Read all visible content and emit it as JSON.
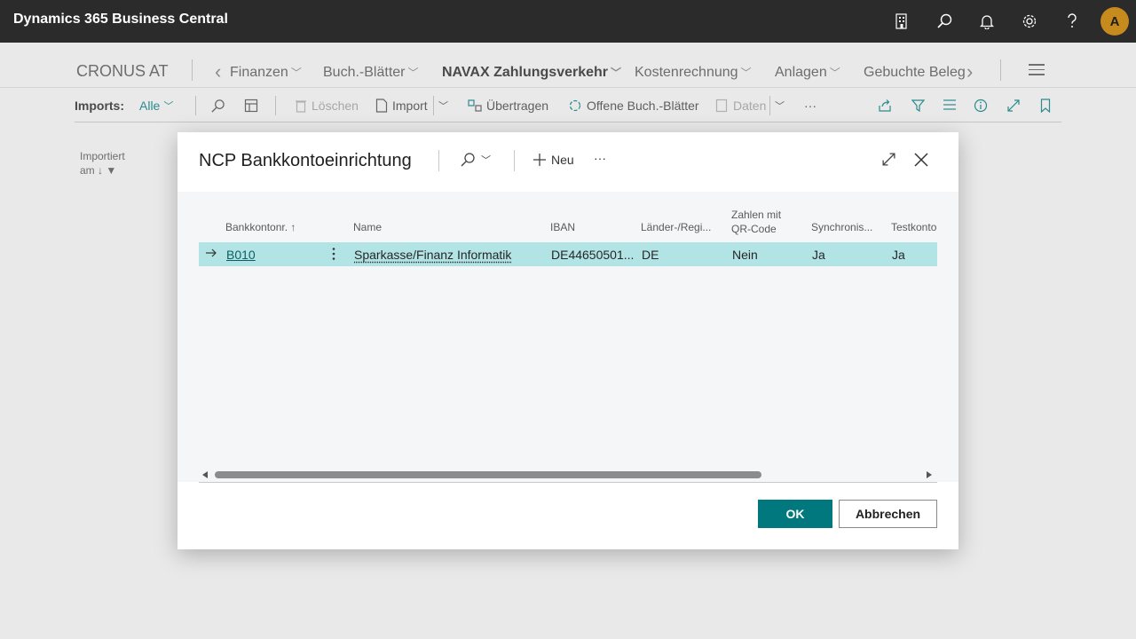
{
  "app": {
    "title": "Dynamics 365 Business Central",
    "avatar_initial": "A"
  },
  "appbar_icons": [
    "company-icon",
    "search-icon",
    "bell-icon",
    "gear-icon",
    "help-icon"
  ],
  "page": {
    "company": "CRONUS AT",
    "nav": [
      {
        "label": "Finanzen"
      },
      {
        "label": "Buch.-Blätter"
      },
      {
        "label": "NAVAX Zahlungsverkehr"
      },
      {
        "label": "Kostenrechnung"
      },
      {
        "label": "Anlagen"
      },
      {
        "label": "Gebuchte Beleg"
      }
    ],
    "toolbar": {
      "imports_label": "Imports:",
      "filter_value": "Alle",
      "delete": "Löschen",
      "import": "Import",
      "transfer": "Übertragen",
      "open_journals": "Offene Buch.-Blätter",
      "data": "Daten",
      "more": "···"
    },
    "column_imported": {
      "line1": "Importiert",
      "line2": "am"
    }
  },
  "modal": {
    "title": "NCP Bankkontoeinrichtung",
    "new_label": "Neu",
    "more": "···",
    "columns": {
      "bank_no": "Bankkontonr.",
      "name": "Name",
      "iban": "IBAN",
      "country": "Länder-/Regi...",
      "qr_line1": "Zahlen mit",
      "qr_line2": "QR-Code",
      "sync": "Synchronis...",
      "test": "Testkonto"
    },
    "rows": [
      {
        "bank_no": "B010",
        "name": "Sparkasse/Finanz Informatik",
        "iban": "DE44650501...",
        "country": "DE",
        "qr": "Nein",
        "sync": "Ja",
        "test": "Ja"
      }
    ],
    "ok": "OK",
    "cancel": "Abbrechen"
  },
  "colors": {
    "accent": "#00787d",
    "selected_row": "#b2e4e6",
    "appbar": "#2b2b2b",
    "avatar": "#c68a1d"
  }
}
